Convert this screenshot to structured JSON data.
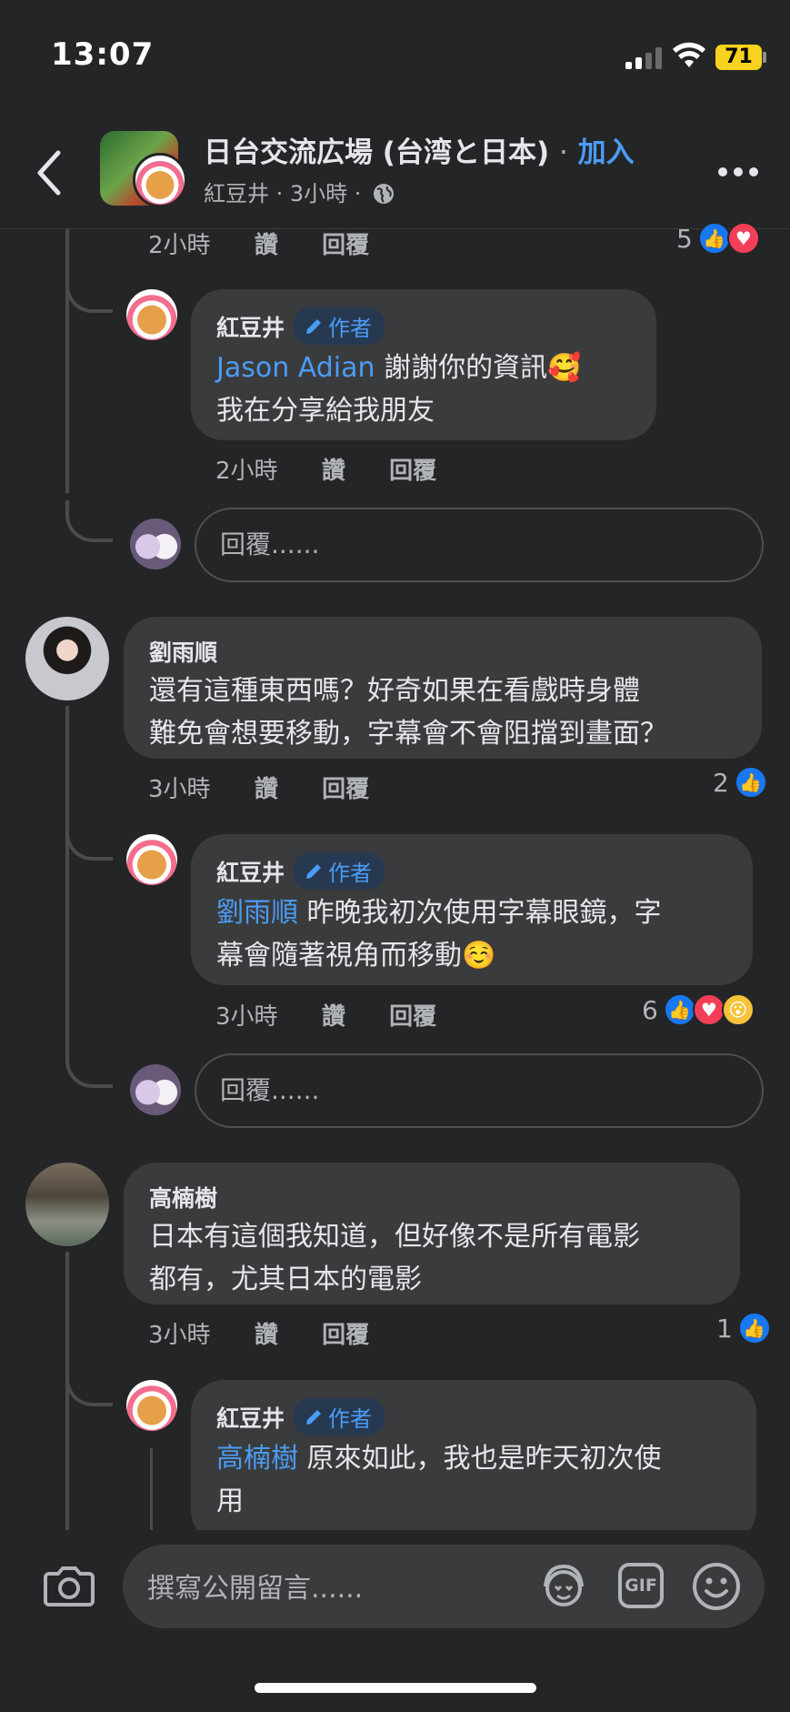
{
  "status_bar": {
    "time": "13:07",
    "battery": "71"
  },
  "header": {
    "title": "日台交流広場 (台湾と日本)",
    "dot": "·",
    "join": "加入",
    "subtitle": "紅豆井 · 3小時 ·"
  },
  "actions": {
    "like": "讚",
    "reply": "回覆",
    "reply_placeholder": "回覆......"
  },
  "author_badge": "作者",
  "thread": {
    "top_meta": {
      "time": "2小時",
      "reactions": "5"
    },
    "comments": [
      {
        "name": "紅豆井",
        "mention": "Jason Adian",
        "text": "謝謝你的資訊🥰",
        "text2": "我在分享給我朋友",
        "time": "2小時"
      },
      {
        "name": "劉雨順",
        "text": "還有這種東西嗎？好奇如果在看戲時身體",
        "text2": "難免會想要移動，字幕會不會阻擋到畫面？",
        "time": "3小時",
        "reactions": "2"
      },
      {
        "name": "紅豆井",
        "mention": "劉雨順",
        "text": "昨晚我初次使用字幕眼鏡，字",
        "text2": "幕會隨著視角而移動☺️",
        "time": "3小時",
        "reactions": "6"
      },
      {
        "name": "高楠樹",
        "text": "日本有這個我知道，但好像不是所有電影",
        "text2": "都有，尤其日本的電影",
        "time": "3小時",
        "reactions": "1"
      },
      {
        "name": "紅豆井",
        "mention": "高楠樹",
        "text": "原來如此，我也是昨天初次使",
        "text2": "用"
      }
    ]
  },
  "composer": {
    "placeholder": "撰寫公開留言......"
  },
  "icons": [
    "back-icon",
    "more-icon",
    "camera-icon",
    "avatar-sticker-icon",
    "gif-icon",
    "emoji-icon",
    "like-icon",
    "love-icon",
    "wow-icon",
    "pencil-icon",
    "globe-icon"
  ],
  "colors": {
    "background": "#242526",
    "bubble": "#3a3b3c",
    "link": "#4b9cf5",
    "like": "#1877f2",
    "love": "#f33e58"
  }
}
